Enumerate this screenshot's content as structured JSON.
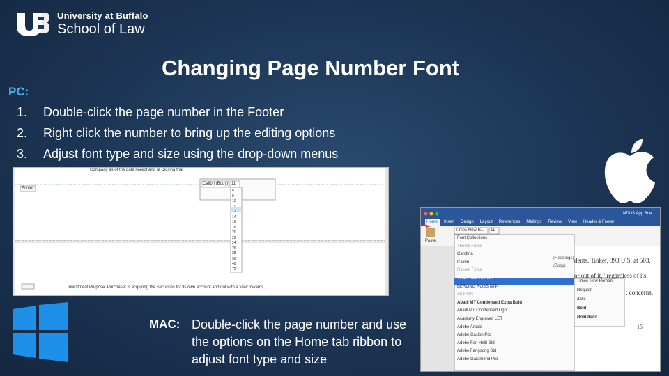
{
  "header": {
    "university": "University at Buffalo",
    "school": "School of Law"
  },
  "title": "Changing Page Number Font",
  "pc": {
    "label": "PC:",
    "steps": [
      {
        "num": "1.",
        "text": "Double-click the page number in the Footer"
      },
      {
        "num": "2.",
        "text": "Right click the number to bring up the editing options"
      },
      {
        "num": "3.",
        "text": "Adjust font type and size using the drop-down menus"
      }
    ],
    "screenshot": {
      "doc_top_text": "Company as of the date hereof and at Closing that",
      "footer_tab": "Footer",
      "font_name": "Calibri (Body)",
      "font_size": "11",
      "size_options": [
        "8",
        "9",
        "10",
        "11",
        "12",
        "14",
        "16",
        "18",
        "20",
        "22",
        "24",
        "26",
        "28",
        "36",
        "48",
        "72"
      ],
      "bottom_text": "Investment Purpose. Purchaser is acquiring the Securities for its own account and not with a view towards,"
    }
  },
  "mac": {
    "label": "MAC:",
    "text": "Double-click the page number and use the options on the Home tab ribbon to adjust font type and size",
    "screenshot": {
      "window_title": "NDUS App Brie",
      "tabs": [
        "Home",
        "Insert",
        "Design",
        "Layout",
        "References",
        "Mailings",
        "Review",
        "View",
        "Header & Footer"
      ],
      "font_box": "Times New R...",
      "size_box": "11",
      "paste": "Paste",
      "menu_items": [
        {
          "label": "Font Collections",
          "arrow": true
        },
        {
          "label": "Theme Fonts",
          "section": true
        },
        {
          "label": "Cambria",
          "note": "(Headings)"
        },
        {
          "label": "Calibri",
          "note": "(Body)"
        },
        {
          "label": "Recent Fonts",
          "section": true
        },
        {
          "label": "Times New Roman",
          "selected": true,
          "arrow": true
        },
        {
          "label": "BERLING ROSS NTP",
          "arrow": true
        },
        {
          "label": "All Fonts",
          "section": true
        },
        {
          "label": "Abadi MT Condensed Extra Bold"
        },
        {
          "label": "Abadi MT Condensed Light"
        },
        {
          "label": "Academy Engraved LET"
        },
        {
          "label": "Adobe Arabic",
          "arrow": true
        },
        {
          "label": "Adobe Caslon Pro",
          "arrow": true
        },
        {
          "label": "Adobe Fan Heiti Std"
        },
        {
          "label": "Adobe Fangsong Std"
        },
        {
          "label": "Adobe Garamond Pro",
          "arrow": true
        }
      ],
      "submenu": [
        "Times New Roman",
        "Regular",
        "Italic",
        "Bold",
        "Bold Italic"
      ],
      "doc_lines": [
        "dents. Tinker, 393 U.S. at 503.",
        "or out of it,\" regardless of its",
        ": concerns."
      ],
      "page_number": "15"
    }
  },
  "colors": {
    "accent_blue": "#4ab4e6",
    "windows_blue": "#1e90e8",
    "word_blue": "#2b579a"
  }
}
